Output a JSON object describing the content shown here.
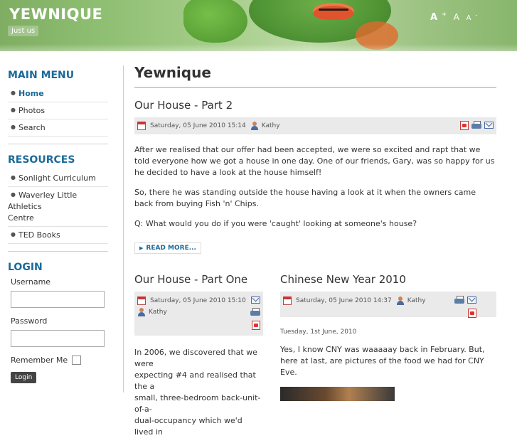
{
  "header": {
    "site_title": "YEWNIQUE",
    "slogan": "Just us",
    "font_controls": {
      "increase": "A",
      "increase_sup": "+",
      "reset": "A",
      "decrease": "A",
      "decrease_sup": "-"
    }
  },
  "sidebar": {
    "main_menu": {
      "title": "MAIN MENU",
      "items": [
        {
          "label": "Home",
          "active": true
        },
        {
          "label": "Photos"
        },
        {
          "label": "Search"
        }
      ]
    },
    "resources": {
      "title": "RESOURCES",
      "items": [
        {
          "label": "Sonlight Curriculum"
        },
        {
          "label": "Waverley Little Athletics",
          "label2": "Centre"
        },
        {
          "label": "TED Books"
        }
      ]
    },
    "login": {
      "title": "LOGIN",
      "username_label": "Username",
      "password_label": "Password",
      "remember_label": "Remember Me",
      "button_label": "Login"
    }
  },
  "main": {
    "page_heading": "Yewnique",
    "lead_article": {
      "title": "Our House - Part 2",
      "date": "Saturday, 05 June 2010 15:14",
      "author": "Kathy",
      "paragraphs": [
        "After we realised that our offer had been accepted, we were so excited and rapt that we told everyone how we got a house in one day.  One of our friends, Gary, was so happy for us he decided to have a look at the house himself!",
        "So, there he was standing outside the house having a look at it when the owners came back from buying Fish 'n' Chips.",
        "Q: What would you do if you were 'caught' looking at someone's house?"
      ],
      "read_more": "READ MORE..."
    },
    "article_left": {
      "title": "Our House - Part One",
      "date": "Saturday, 05 June 2010 15:10",
      "author": "Kathy",
      "text_lines": [
        "In 2006, we discovered that we were",
        "expecting #4 and realised that the a",
        "small, three-bedroom back-unit-of-a-",
        "dual-occupancy which we'd lived in"
      ]
    },
    "article_right": {
      "title": "Chinese New Year 2010",
      "date": "Saturday, 05 June 2010 14:37",
      "author": "Kathy",
      "created": "Tuesday, 1st June, 2010",
      "text": "Yes, I know CNY was waaaaay back in February.  But, here at last, are pictures of the food we had for CNY Eve."
    }
  },
  "colors": {
    "accent": "#1a6a9a",
    "header_green": "#8fbf72",
    "meta_bg": "#eaeaea"
  }
}
